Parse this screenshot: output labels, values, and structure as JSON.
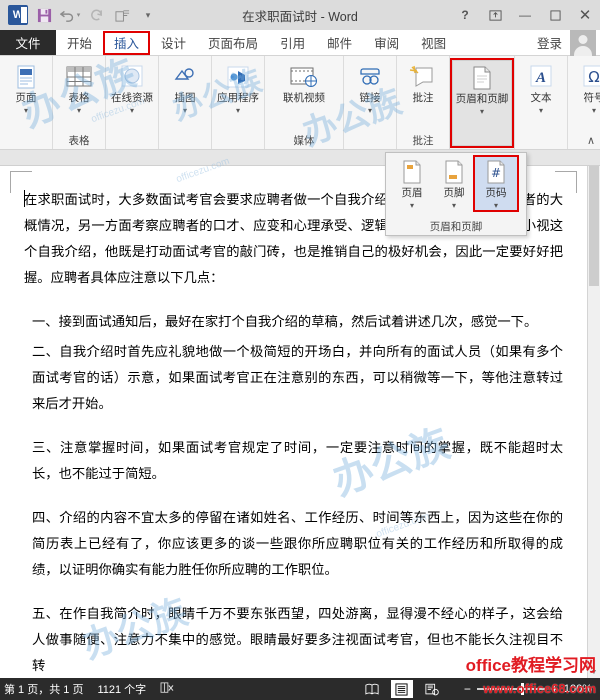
{
  "window": {
    "title": "在求职面试时 - Word",
    "quick_access": [
      {
        "name": "word-logo",
        "glyph": "W"
      },
      {
        "name": "save-icon",
        "glyph": "⬛"
      },
      {
        "name": "undo-icon",
        "glyph": "↶"
      },
      {
        "name": "redo-icon",
        "glyph": "↻"
      },
      {
        "name": "touch-mode-icon",
        "glyph": "❐"
      },
      {
        "name": "qat-more-icon",
        "glyph": "▾"
      }
    ],
    "controls": [
      {
        "name": "help-button",
        "glyph": "?"
      },
      {
        "name": "ribbon-display-options-button",
        "glyph": "⬚"
      },
      {
        "name": "minimize-button",
        "glyph": "—"
      },
      {
        "name": "maximize-button",
        "glyph": "❐"
      },
      {
        "name": "close-button",
        "glyph": "✕"
      }
    ]
  },
  "tabs": {
    "file": "文件",
    "items": [
      {
        "label": "开始",
        "active": false
      },
      {
        "label": "插入",
        "active": true
      },
      {
        "label": "设计",
        "active": false
      },
      {
        "label": "页面布局",
        "active": false
      },
      {
        "label": "引用",
        "active": false
      },
      {
        "label": "邮件",
        "active": false
      },
      {
        "label": "审阅",
        "active": false
      },
      {
        "label": "视图",
        "active": false
      }
    ],
    "signin": "登录"
  },
  "ribbon": {
    "groups": [
      {
        "label": "",
        "buttons": [
          {
            "label": "页面",
            "icon": "page-icon",
            "caret": true
          }
        ]
      },
      {
        "label": "表格",
        "buttons": [
          {
            "label": "表格",
            "icon": "table-icon",
            "caret": true
          }
        ]
      },
      {
        "label": "",
        "buttons": [
          {
            "label": "在线资源",
            "icon": "online-resource-icon",
            "caret": true
          }
        ]
      },
      {
        "label": "",
        "buttons": [
          {
            "label": "插图",
            "icon": "illustration-icon",
            "caret": true
          }
        ]
      },
      {
        "label": "",
        "buttons": [
          {
            "label": "应用程序",
            "icon": "apps-icon",
            "caret": true
          }
        ]
      },
      {
        "label": "媒体",
        "buttons": [
          {
            "label": "联机视频",
            "icon": "online-video-icon",
            "caret": false
          }
        ]
      },
      {
        "label": "",
        "buttons": [
          {
            "label": "链接",
            "icon": "link-icon",
            "caret": true
          }
        ]
      },
      {
        "label": "批注",
        "buttons": [
          {
            "label": "批注",
            "icon": "comment-icon",
            "caret": false
          }
        ]
      },
      {
        "label": "",
        "buttons": [
          {
            "label": "页眉和页脚",
            "icon": "header-footer-icon",
            "caret": true,
            "selected": true,
            "highlighted": true
          }
        ]
      },
      {
        "label": "",
        "buttons": [
          {
            "label": "文本",
            "icon": "text-icon",
            "caret": true
          }
        ]
      },
      {
        "label": "",
        "buttons": [
          {
            "label": "符号",
            "icon": "symbol-icon",
            "caret": true
          }
        ]
      }
    ],
    "collapse_glyph": "∧"
  },
  "dropdown": {
    "group_label": "页眉和页脚",
    "items": [
      {
        "label": "页眉",
        "icon": "header-page-icon",
        "caret": true,
        "selected": false
      },
      {
        "label": "页脚",
        "icon": "footer-page-icon",
        "caret": true,
        "selected": false
      },
      {
        "label": "页码",
        "icon": "page-number-icon",
        "caret": true,
        "selected": true
      }
    ]
  },
  "document": {
    "paragraphs": [
      "在求职面试时，大多数面试考官会要求应聘者做一个自我介绍，一方面以此了解应聘者的大概情况，另一方面考察应聘者的口才、应变和心理承受、逻辑思维等能力。千万不要小视这个自我介绍，他既是打动面试考官的敲门砖，也是推销自己的极好机会，因此一定要好好把握。应聘者具体应注意以下几点：",
      "一、接到面试通知后，最好在家打个自我介绍的草稿，然后试着讲述几次，感觉一下。",
      "二、自我介绍时首先应礼貌地做一个极简短的开场白，并向所有的面试人员（如果有多个面试考官的话）示意，如果面试考官正在注意别的东西，可以稍微等一下，等他注意转过来后才开始。",
      "三、注意掌握时间，如果面试考官规定了时间，一定要注意时间的掌握，既不能超时太长，也不能过于简短。",
      "四、介绍的内容不宜太多的停留在诸如姓名、工作经历、时间等东西上，因为这些在你的简历表上已经有了，你应该更多的谈一些跟你所应聘职位有关的工作经历和所取得的成绩，以证明你确实有能力胜任你所应聘的工作职位。",
      "五、在作自我简介时，眼睛千万不要东张西望，四处游离，显得漫不经心的样子，这会给人做事随便、注意力不集中的感觉。眼睛最好要多注视面试考官，但也不能长久注视目不转"
    ]
  },
  "statusbar": {
    "page_info": "第 1 页，共 1 页",
    "word_count": "1121 个字",
    "proofing_icon": "☐✗",
    "views": [
      {
        "name": "read-mode-view-button",
        "glyph": "☷",
        "active": false
      },
      {
        "name": "print-layout-view-button",
        "glyph": "☰",
        "active": true
      },
      {
        "name": "web-layout-view-button",
        "glyph": "☲",
        "active": false
      }
    ],
    "zoom_out": "−",
    "zoom_in": "+",
    "zoom_value": "100%"
  },
  "watermarks": {
    "blue_text": "办公族",
    "blue_small": "officezu.com",
    "red_line1": "office教程学习网",
    "red_line2": "www.office68.com"
  }
}
